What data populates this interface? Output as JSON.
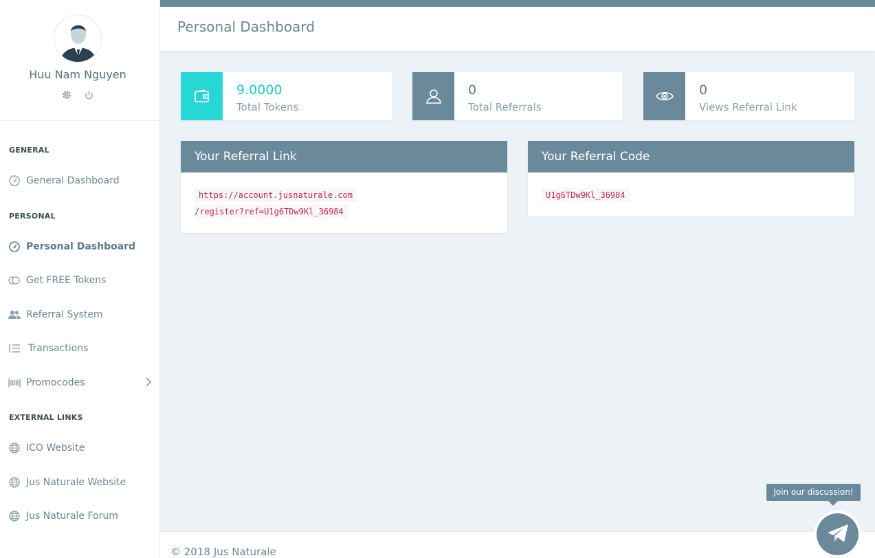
{
  "profile": {
    "name": "Huu Nam Nguyen",
    "settings_icon": "gear-icon",
    "logout_icon": "power-icon"
  },
  "sidebar": {
    "sections": [
      {
        "title": "GENERAL",
        "items": [
          {
            "label": "General Dashboard",
            "icon": "dashboard-gauge-icon"
          }
        ]
      },
      {
        "title": "PERSONAL",
        "items": [
          {
            "label": "Personal Dashboard",
            "icon": "dashboard-gauge-icon",
            "active": true
          },
          {
            "label": "Get FREE Tokens",
            "icon": "coins-icon"
          },
          {
            "label": "Referral System",
            "icon": "users-icon"
          },
          {
            "label": "Transactions",
            "icon": "list-icon"
          },
          {
            "label": "Promocodes",
            "icon": "barcode-icon"
          }
        ]
      },
      {
        "title": "EXTERNAL LINKS",
        "items": [
          {
            "label": "ICO Website",
            "icon": "globe-icon"
          },
          {
            "label": "Jus Naturale Website",
            "icon": "globe-icon"
          },
          {
            "label": "Jus Naturale Forum",
            "icon": "globe-icon"
          }
        ]
      }
    ]
  },
  "header": {
    "title": "Personal Dashboard"
  },
  "stats": [
    {
      "value": "9.0000",
      "label": "Total Tokens",
      "icon": "wallet-icon"
    },
    {
      "value": "0",
      "label": "Total Referrals",
      "icon": "user-icon"
    },
    {
      "value": "0",
      "label": "Views Referral Link",
      "icon": "eye-icon"
    }
  ],
  "referral_link": {
    "title": "Your Referral Link",
    "line1": "https://account.jusnaturale.com",
    "line2": "/register?ref=U1g6TDw9Kl_36984"
  },
  "referral_code": {
    "title": "Your Referral Code",
    "code": "U1g6TDw9Kl_36984"
  },
  "footer": {
    "text": "© 2018 Jus Naturale"
  },
  "chat": {
    "tooltip": "Join our discussion!",
    "icon": "telegram-icon"
  },
  "colors": {
    "accent": "#6a8a9b",
    "teal": "#26d7d6",
    "background": "#ecf2f5"
  }
}
